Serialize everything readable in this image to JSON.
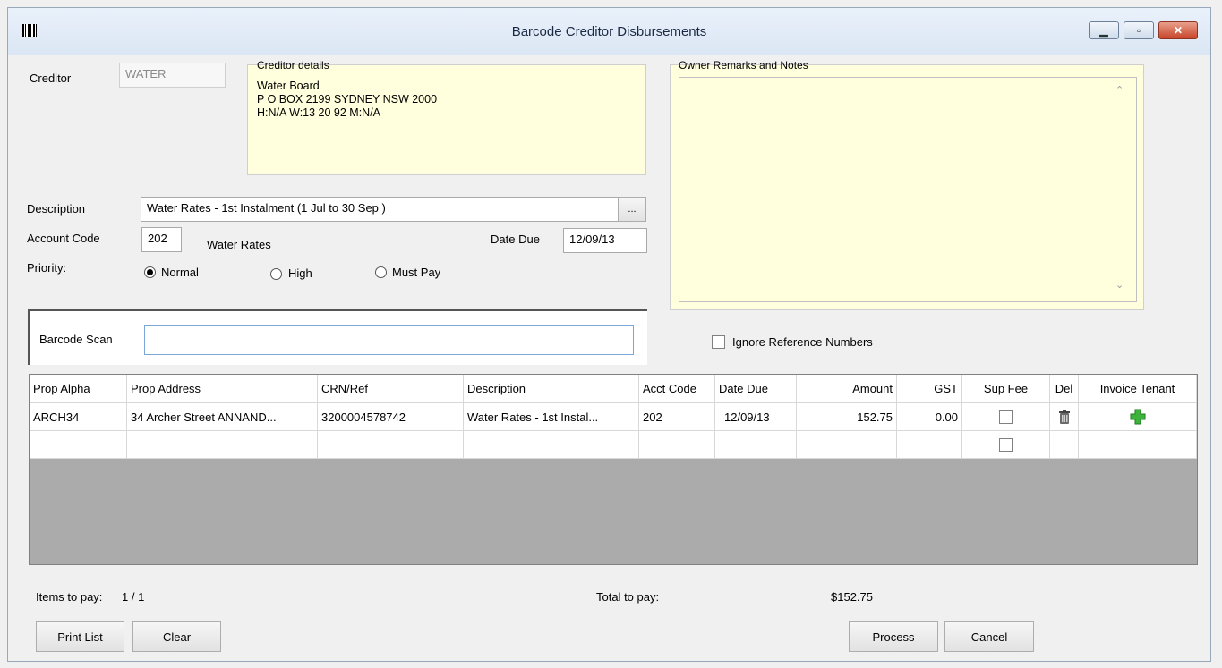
{
  "window": {
    "title": "Barcode Creditor Disbursements",
    "icon": "barcode-icon",
    "minimize_glyph": "▁",
    "maximize_glyph": "▫",
    "close_glyph": "✕"
  },
  "creditor": {
    "label": "Creditor",
    "value": "WATER",
    "details_label": "Creditor details",
    "details_lines": [
      "Water Board",
      "P O BOX 2199 SYDNEY NSW 2000",
      "H:N/A W:13 20 92 M:N/A"
    ]
  },
  "remarks": {
    "label": "Owner Remarks and Notes",
    "value": ""
  },
  "description": {
    "label": "Description",
    "value": "Water Rates - 1st Instalment (1 Jul to 30 Sep )",
    "browse_label": "..."
  },
  "account_code": {
    "label": "Account Code",
    "value": "202",
    "name": "Water Rates"
  },
  "date_due": {
    "label": "Date Due",
    "value": "12/09/13"
  },
  "priority": {
    "label": "Priority:",
    "options": [
      "Normal",
      "High",
      "Must Pay"
    ],
    "selected": "Normal"
  },
  "barcode_scan": {
    "label": "Barcode Scan",
    "value": ""
  },
  "ignore_ref": {
    "label": "Ignore Reference Numbers",
    "checked": false
  },
  "table": {
    "columns": [
      "Prop Alpha",
      "Prop Address",
      "CRN/Ref",
      "Description",
      "Acct Code",
      "Date Due",
      "Amount",
      "GST",
      "Sup Fee",
      "Del",
      "Invoice Tenant"
    ],
    "rows": [
      {
        "prop_alpha": "ARCH34",
        "prop_address": "34 Archer Street ANNAND...",
        "crn_ref": "3200004578742",
        "description": "Water Rates - 1st Instal...",
        "acct_code": "202",
        "date_due": "12/09/13",
        "amount": "152.75",
        "gst": "0.00",
        "sup_fee": false,
        "del_icon": "trash-icon",
        "invoice_icon": "plus-icon"
      },
      {
        "prop_alpha": "",
        "prop_address": "",
        "crn_ref": "",
        "description": "",
        "acct_code": "",
        "date_due": "",
        "amount": "",
        "gst": "",
        "sup_fee": false,
        "del_icon": "",
        "invoice_icon": ""
      }
    ]
  },
  "footer": {
    "items_label": "Items to pay:",
    "items_value": "1 / 1",
    "total_label": "Total to pay:",
    "total_value": "$152.75",
    "print_label": "Print List",
    "clear_label": "Clear",
    "process_label": "Process",
    "cancel_label": "Cancel"
  },
  "colors": {
    "note_bg": "#ffffdd",
    "grid_empty": "#ababab",
    "accent_border": "#7aa7d8",
    "plus_green": "#3cb43c"
  }
}
